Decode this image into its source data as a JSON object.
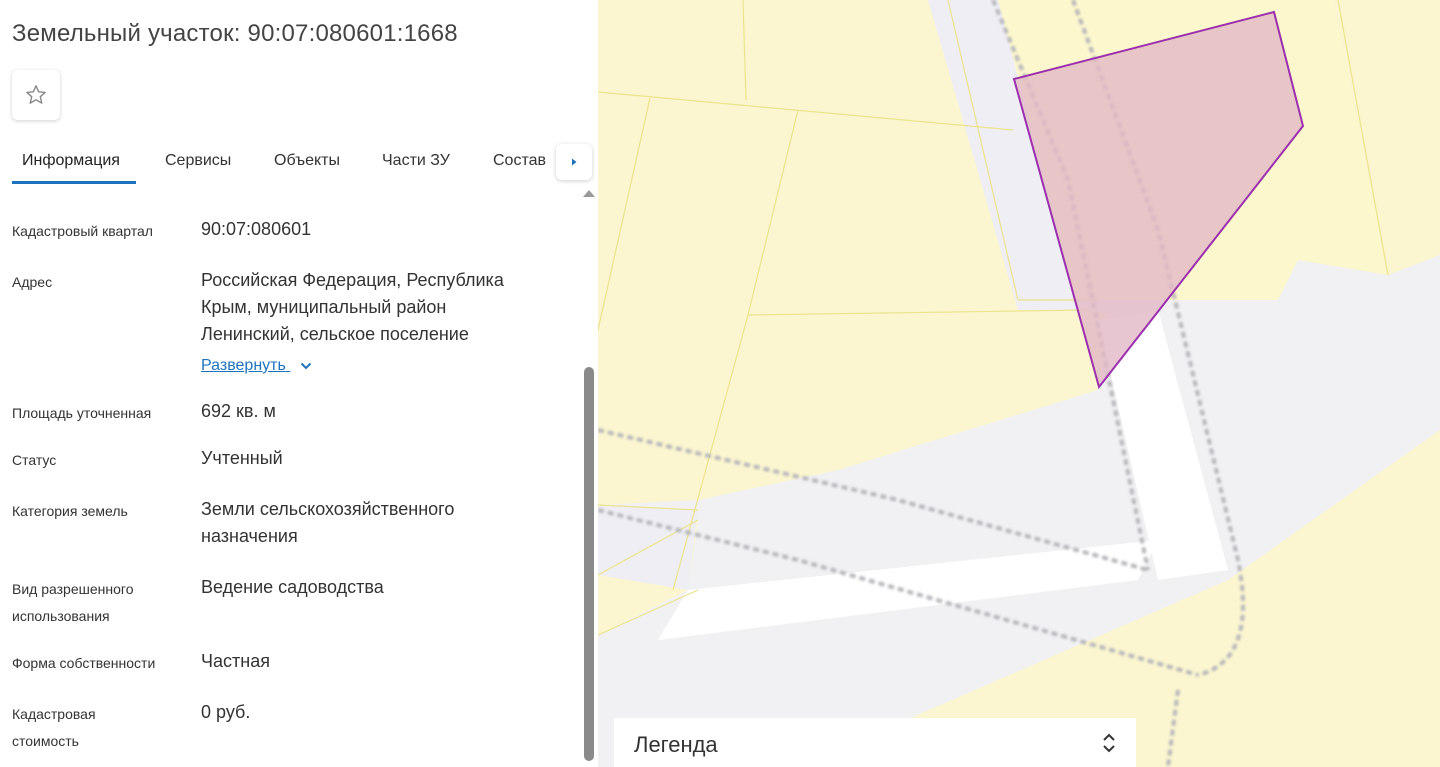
{
  "header": {
    "title": "Земельный участок: 90:07:080601:1668",
    "favorite_icon": "star-outline-icon"
  },
  "tabs": [
    {
      "label": "Информация",
      "active": true
    },
    {
      "label": "Сервисы",
      "active": false
    },
    {
      "label": "Объекты",
      "active": false
    },
    {
      "label": "Части ЗУ",
      "active": false
    },
    {
      "label": "Состав",
      "active": false
    }
  ],
  "tab_scroll_icon": "caret-right-icon",
  "info": {
    "cadastral_quarter": {
      "label": "Кадастровый квартал",
      "value": "90:07:080601"
    },
    "address": {
      "label": "Адрес",
      "lines": [
        "Российская Федерация, Республика",
        "Крым, муниципальный район",
        "Ленинский, сельское поселение"
      ],
      "expand_label": "Развернуть"
    },
    "area": {
      "label": "Площадь уточненная",
      "value": "692 кв. м"
    },
    "status": {
      "label": "Статус",
      "value": "Учтенный"
    },
    "land_category": {
      "label": "Категория земель",
      "lines": [
        "Земли сельскохозяйственного",
        "назначения"
      ]
    },
    "permitted_use": {
      "label_lines": [
        "Вид разрешенного",
        "использования"
      ],
      "value": "Ведение садоводства"
    },
    "ownership": {
      "label": "Форма собственности",
      "value": "Частная"
    },
    "cadastral_value": {
      "label_lines": [
        "Кадастровая",
        "стоимость"
      ],
      "value": "0 руб."
    }
  },
  "legend": {
    "label": "Легенда",
    "toggle_icon": "chevron-up-down-icon"
  },
  "colors": {
    "accent": "#1e73be",
    "parcel_stroke": "#9b2fae",
    "parcel_fill": "#e2b8c6",
    "parcel_bg": "#fbf6cf"
  }
}
